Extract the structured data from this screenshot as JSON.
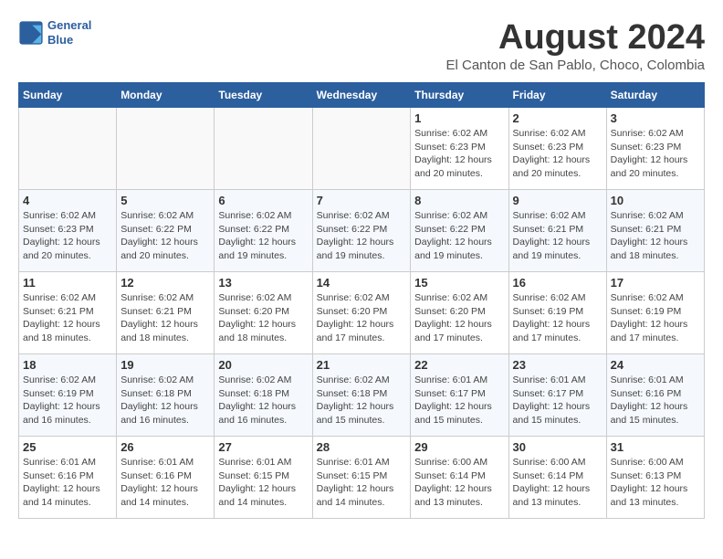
{
  "header": {
    "logo_line1": "General",
    "logo_line2": "Blue",
    "month_title": "August 2024",
    "location": "El Canton de San Pablo, Choco, Colombia"
  },
  "weekdays": [
    "Sunday",
    "Monday",
    "Tuesday",
    "Wednesday",
    "Thursday",
    "Friday",
    "Saturday"
  ],
  "weeks": [
    [
      {
        "day": "",
        "info": ""
      },
      {
        "day": "",
        "info": ""
      },
      {
        "day": "",
        "info": ""
      },
      {
        "day": "",
        "info": ""
      },
      {
        "day": "1",
        "info": "Sunrise: 6:02 AM\nSunset: 6:23 PM\nDaylight: 12 hours\nand 20 minutes."
      },
      {
        "day": "2",
        "info": "Sunrise: 6:02 AM\nSunset: 6:23 PM\nDaylight: 12 hours\nand 20 minutes."
      },
      {
        "day": "3",
        "info": "Sunrise: 6:02 AM\nSunset: 6:23 PM\nDaylight: 12 hours\nand 20 minutes."
      }
    ],
    [
      {
        "day": "4",
        "info": "Sunrise: 6:02 AM\nSunset: 6:23 PM\nDaylight: 12 hours\nand 20 minutes."
      },
      {
        "day": "5",
        "info": "Sunrise: 6:02 AM\nSunset: 6:22 PM\nDaylight: 12 hours\nand 20 minutes."
      },
      {
        "day": "6",
        "info": "Sunrise: 6:02 AM\nSunset: 6:22 PM\nDaylight: 12 hours\nand 19 minutes."
      },
      {
        "day": "7",
        "info": "Sunrise: 6:02 AM\nSunset: 6:22 PM\nDaylight: 12 hours\nand 19 minutes."
      },
      {
        "day": "8",
        "info": "Sunrise: 6:02 AM\nSunset: 6:22 PM\nDaylight: 12 hours\nand 19 minutes."
      },
      {
        "day": "9",
        "info": "Sunrise: 6:02 AM\nSunset: 6:21 PM\nDaylight: 12 hours\nand 19 minutes."
      },
      {
        "day": "10",
        "info": "Sunrise: 6:02 AM\nSunset: 6:21 PM\nDaylight: 12 hours\nand 18 minutes."
      }
    ],
    [
      {
        "day": "11",
        "info": "Sunrise: 6:02 AM\nSunset: 6:21 PM\nDaylight: 12 hours\nand 18 minutes."
      },
      {
        "day": "12",
        "info": "Sunrise: 6:02 AM\nSunset: 6:21 PM\nDaylight: 12 hours\nand 18 minutes."
      },
      {
        "day": "13",
        "info": "Sunrise: 6:02 AM\nSunset: 6:20 PM\nDaylight: 12 hours\nand 18 minutes."
      },
      {
        "day": "14",
        "info": "Sunrise: 6:02 AM\nSunset: 6:20 PM\nDaylight: 12 hours\nand 17 minutes."
      },
      {
        "day": "15",
        "info": "Sunrise: 6:02 AM\nSunset: 6:20 PM\nDaylight: 12 hours\nand 17 minutes."
      },
      {
        "day": "16",
        "info": "Sunrise: 6:02 AM\nSunset: 6:19 PM\nDaylight: 12 hours\nand 17 minutes."
      },
      {
        "day": "17",
        "info": "Sunrise: 6:02 AM\nSunset: 6:19 PM\nDaylight: 12 hours\nand 17 minutes."
      }
    ],
    [
      {
        "day": "18",
        "info": "Sunrise: 6:02 AM\nSunset: 6:19 PM\nDaylight: 12 hours\nand 16 minutes."
      },
      {
        "day": "19",
        "info": "Sunrise: 6:02 AM\nSunset: 6:18 PM\nDaylight: 12 hours\nand 16 minutes."
      },
      {
        "day": "20",
        "info": "Sunrise: 6:02 AM\nSunset: 6:18 PM\nDaylight: 12 hours\nand 16 minutes."
      },
      {
        "day": "21",
        "info": "Sunrise: 6:02 AM\nSunset: 6:18 PM\nDaylight: 12 hours\nand 15 minutes."
      },
      {
        "day": "22",
        "info": "Sunrise: 6:01 AM\nSunset: 6:17 PM\nDaylight: 12 hours\nand 15 minutes."
      },
      {
        "day": "23",
        "info": "Sunrise: 6:01 AM\nSunset: 6:17 PM\nDaylight: 12 hours\nand 15 minutes."
      },
      {
        "day": "24",
        "info": "Sunrise: 6:01 AM\nSunset: 6:16 PM\nDaylight: 12 hours\nand 15 minutes."
      }
    ],
    [
      {
        "day": "25",
        "info": "Sunrise: 6:01 AM\nSunset: 6:16 PM\nDaylight: 12 hours\nand 14 minutes."
      },
      {
        "day": "26",
        "info": "Sunrise: 6:01 AM\nSunset: 6:16 PM\nDaylight: 12 hours\nand 14 minutes."
      },
      {
        "day": "27",
        "info": "Sunrise: 6:01 AM\nSunset: 6:15 PM\nDaylight: 12 hours\nand 14 minutes."
      },
      {
        "day": "28",
        "info": "Sunrise: 6:01 AM\nSunset: 6:15 PM\nDaylight: 12 hours\nand 14 minutes."
      },
      {
        "day": "29",
        "info": "Sunrise: 6:00 AM\nSunset: 6:14 PM\nDaylight: 12 hours\nand 13 minutes."
      },
      {
        "day": "30",
        "info": "Sunrise: 6:00 AM\nSunset: 6:14 PM\nDaylight: 12 hours\nand 13 minutes."
      },
      {
        "day": "31",
        "info": "Sunrise: 6:00 AM\nSunset: 6:13 PM\nDaylight: 12 hours\nand 13 minutes."
      }
    ]
  ]
}
